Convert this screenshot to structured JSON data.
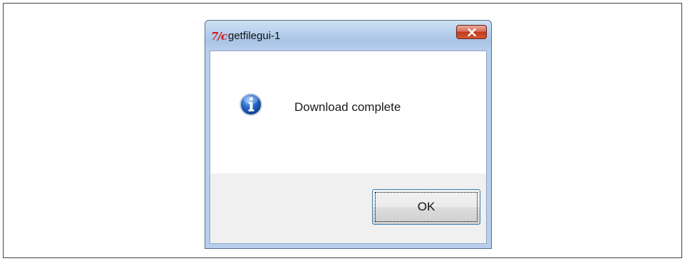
{
  "window": {
    "title": "getfilegui-1",
    "app_icon": "tk-feather-icon",
    "close_icon": "close-icon"
  },
  "message": {
    "icon": "info-icon",
    "text": "Download complete"
  },
  "buttons": {
    "ok_label": "OK"
  },
  "colors": {
    "close_button": "#c1391c",
    "info_icon_blue": "#1f5fb8",
    "button_area_bg": "#f0f0f0",
    "ok_focus_border": "#3c7fb1"
  }
}
